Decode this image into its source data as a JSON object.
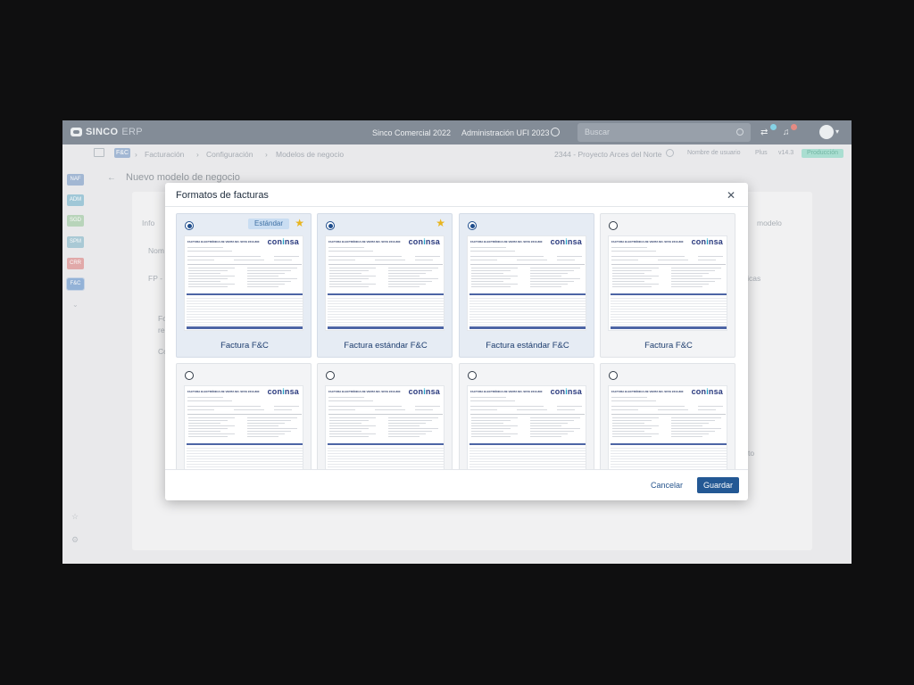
{
  "app": {
    "logo_sinco": "SINCO",
    "logo_erp": "ERP",
    "company": "Sinco Comercial 2022",
    "admin": "Administración UFI 2023",
    "search_placeholder": "Buscar",
    "notif_count_a": "1",
    "notif_count_b": "2"
  },
  "breadcrumb": {
    "module_tag": "F&C",
    "items": [
      "Facturación",
      "Configuración",
      "Modelos de negocio"
    ],
    "project": "2344 - Proyecto Arces del Norte",
    "user": "Nombre de usuario",
    "plan": "Plus",
    "version": "v14.3",
    "env": "Producción"
  },
  "rail": {
    "modules": [
      {
        "label": "NAF",
        "color": "#9fb6d4"
      },
      {
        "label": "ADM",
        "color": "#9cc7d8"
      },
      {
        "label": "SGD",
        "color": "#b7d5b9"
      },
      {
        "label": "SPM",
        "color": "#a6c9d6"
      },
      {
        "label": "CRR",
        "color": "#e3a6a6"
      },
      {
        "label": "F&C",
        "color": "#8fb0d8"
      }
    ]
  },
  "page": {
    "title": "Nuevo modelo de negocio",
    "bg_info": "Info",
    "bg_nom": "Nom",
    "bg_fp": "FP -",
    "bg_modelo": "modelo",
    "bg_aticas": "áticas",
    "bg_fo": "Fo",
    "bg_re": "re",
    "bg_co": "Co",
    "bg_to": "to"
  },
  "modal": {
    "title": "Formatos de facturas",
    "cancel_label": "Cancelar",
    "save_label": "Guardar",
    "standard_badge": "Estándar",
    "doc_title_text": "FACTURA ELECTRÓNICA DE VENTA NO. SFFE 2213-890",
    "brand_main": "con",
    "brand_accent": "i",
    "brand_tail": "nsa",
    "cards": [
      {
        "label": "Factura  F&C",
        "selected": true,
        "badge": true,
        "star": true
      },
      {
        "label": "Factura estándar F&C",
        "selected": true,
        "badge": false,
        "star": true
      },
      {
        "label": "Factura estándar F&C",
        "selected": true,
        "badge": false,
        "star": false
      },
      {
        "label": "Factura F&C",
        "selected": false,
        "badge": false,
        "star": false
      },
      {
        "label": "",
        "selected": false,
        "badge": false,
        "star": false
      },
      {
        "label": "",
        "selected": false,
        "badge": false,
        "star": false
      },
      {
        "label": "",
        "selected": false,
        "badge": false,
        "star": false
      },
      {
        "label": "",
        "selected": false,
        "badge": false,
        "star": false
      }
    ]
  }
}
